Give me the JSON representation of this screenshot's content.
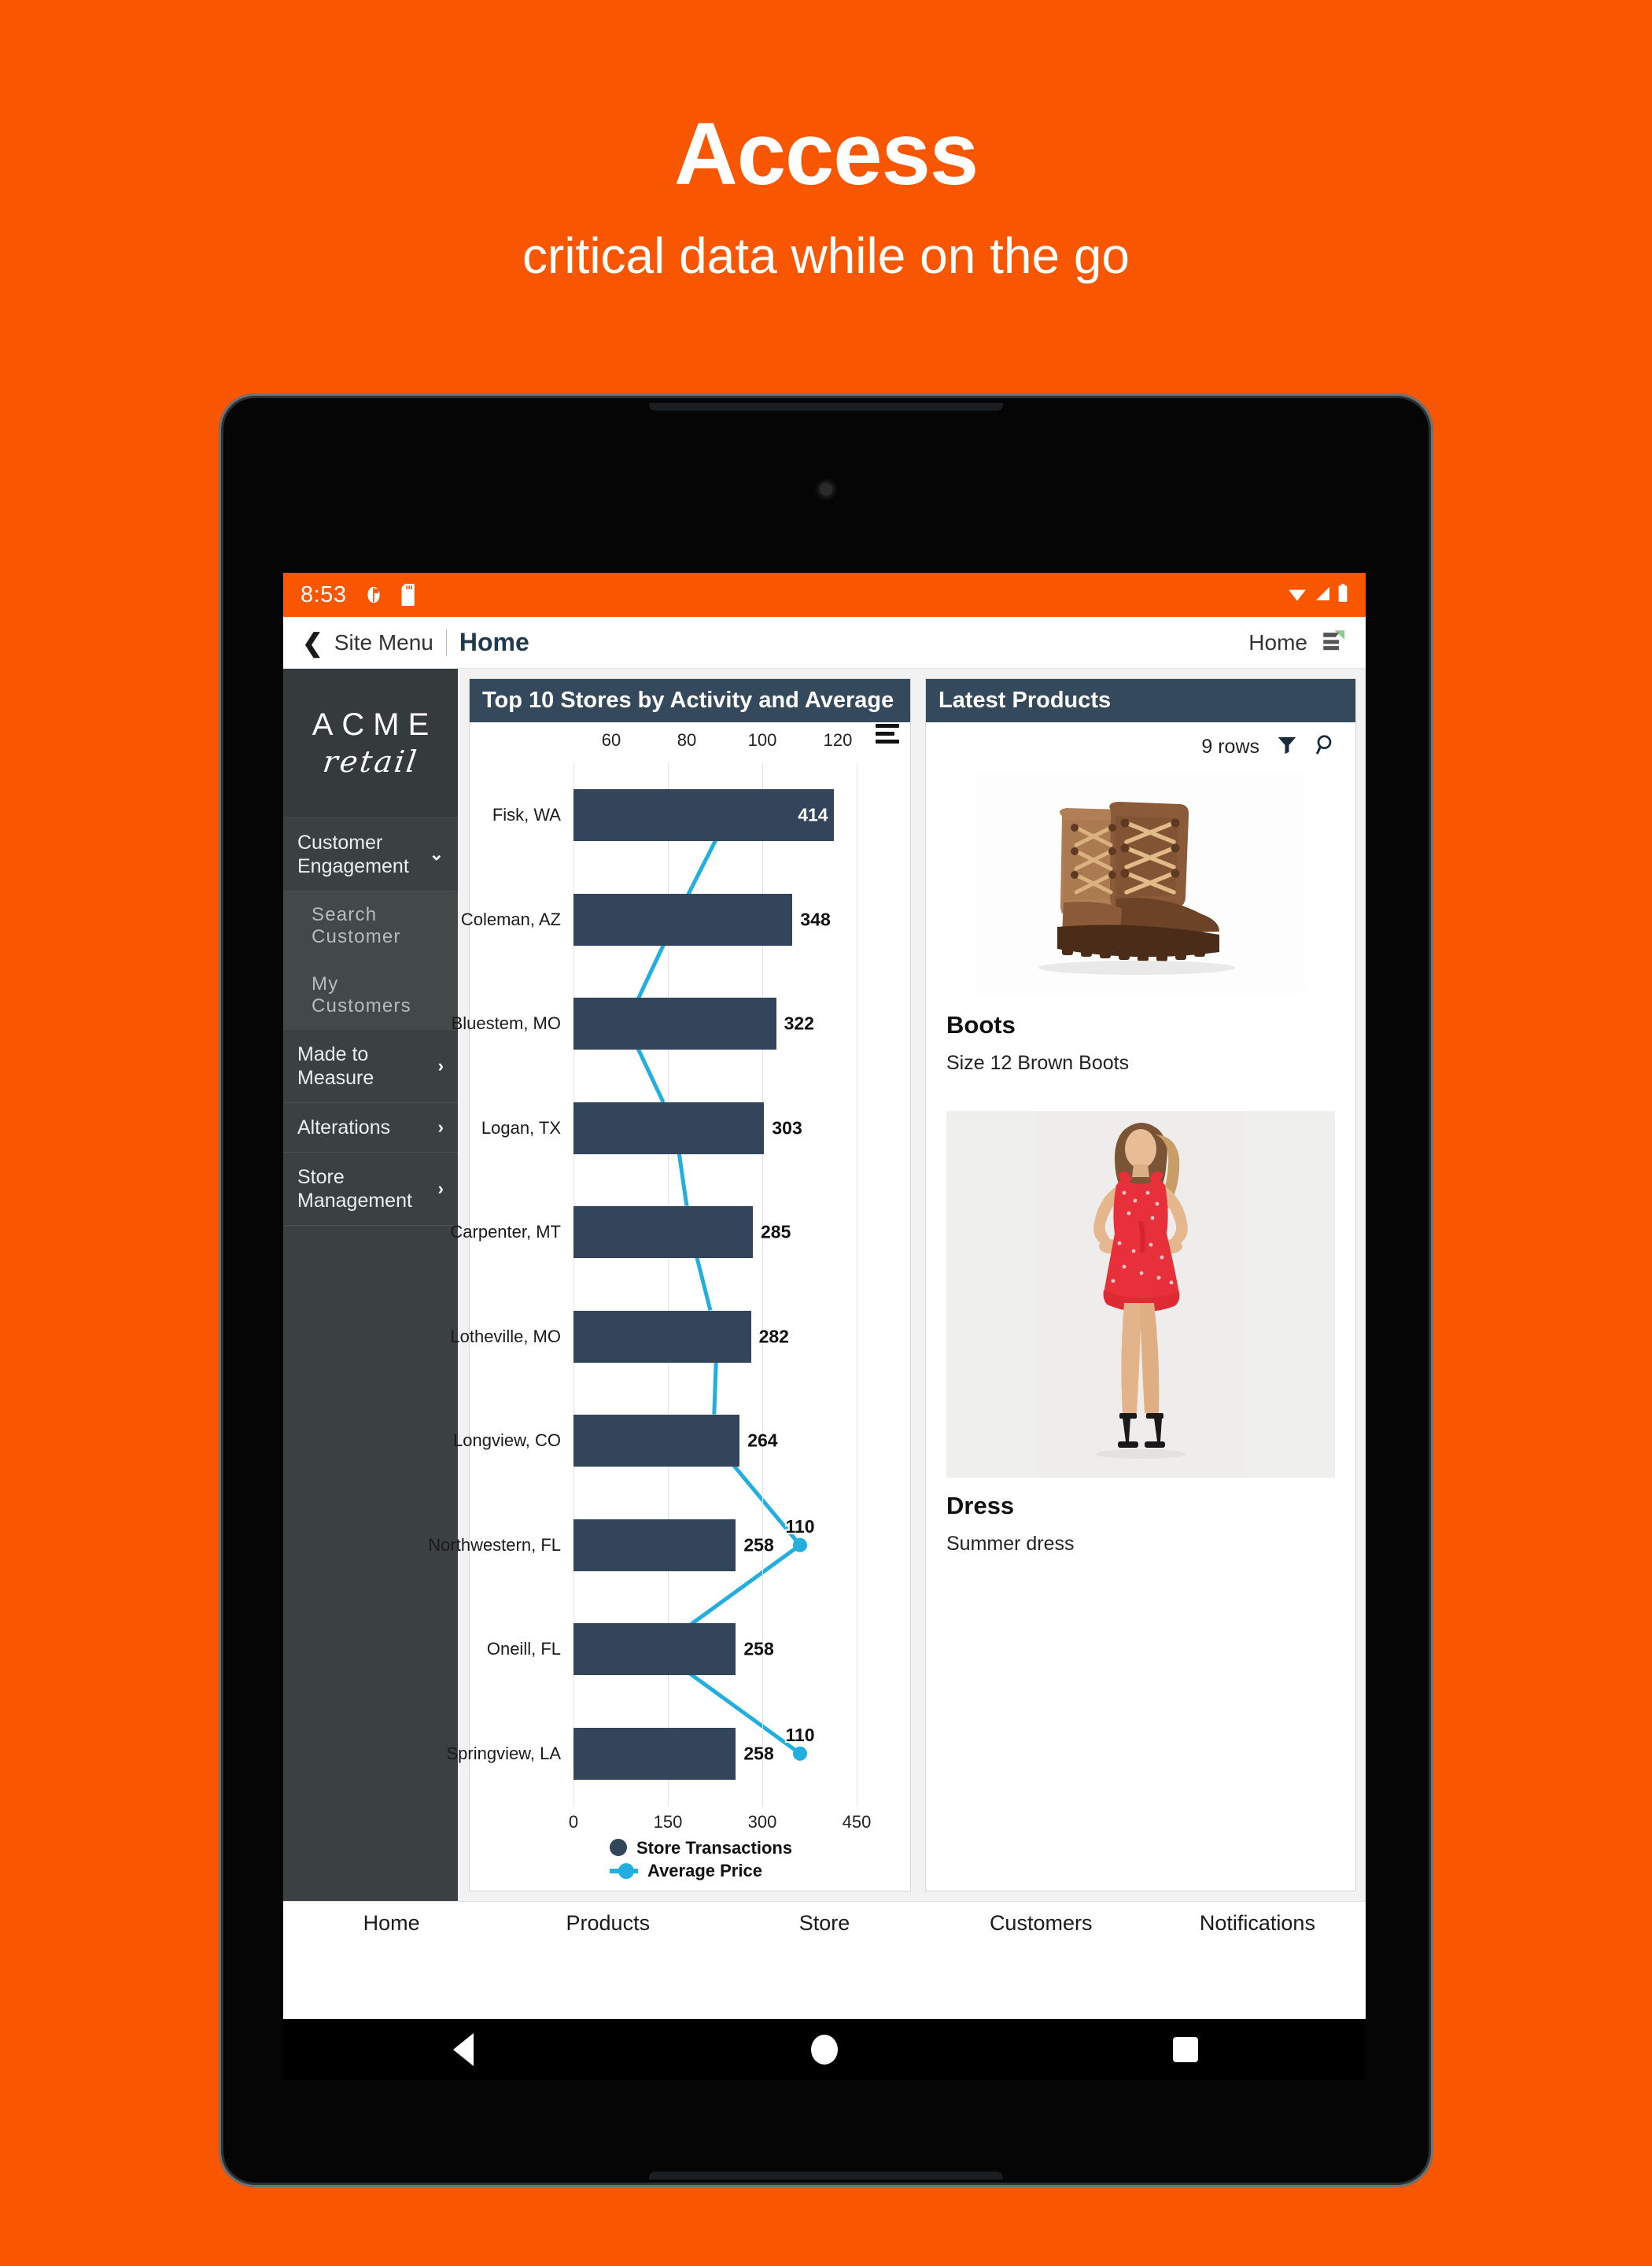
{
  "promo": {
    "title": "Access",
    "subtitle": "critical data while on the go"
  },
  "status_bar": {
    "time": "8:53",
    "icons": [
      "screen-rotation-icon",
      "sd-card-icon"
    ],
    "right_icons": [
      "wifi-icon",
      "signal-icon",
      "battery-icon"
    ]
  },
  "app_header": {
    "back_icon": "chevron-left-icon",
    "site_menu": "Site Menu",
    "page_title": "Home",
    "right_label": "Home",
    "right_icon": "layers-icon"
  },
  "sidebar": {
    "logo_primary": "ACME",
    "logo_secondary": "retail",
    "items": [
      {
        "label": "Customer Engagement",
        "icon": "chevron-down-icon",
        "expanded": true
      },
      {
        "label": "Search Customer",
        "sub": true
      },
      {
        "label": "My Customers",
        "sub": true
      },
      {
        "label": "Made to Measure",
        "icon": "chevron-right-icon"
      },
      {
        "label": "Alterations",
        "icon": "chevron-right-icon"
      },
      {
        "label": "Store Management",
        "icon": "chevron-right-icon"
      }
    ]
  },
  "chart_card": {
    "title": "Top 10 Stores by Activity and Average",
    "menu_icon": "hamburger-menu-icon"
  },
  "chart_data": {
    "type": "bar",
    "title": "Top 10 Stores by Activity and Average",
    "orientation": "horizontal",
    "categories": [
      "Fisk, WA",
      "Coleman, AZ",
      "Bluestem, MO",
      "Logan, TX",
      "Carpenter, MT",
      "Lotheville, MO",
      "Longview, CO",
      "Northwestern, FL",
      "Oneill, FL",
      "Springview, LA"
    ],
    "series": [
      {
        "name": "Store Transactions",
        "type": "bar",
        "color": "#33455a",
        "values": [
          414,
          348,
          322,
          303,
          285,
          282,
          264,
          258,
          258,
          258
        ],
        "axis": "bottom",
        "axis_label": "",
        "ticks": [
          0,
          150,
          300,
          450
        ],
        "range": [
          0,
          450
        ]
      },
      {
        "name": "Average Price",
        "type": "line",
        "color": "#22aede",
        "values": [
          91,
          77,
          64,
          77,
          81,
          88,
          87,
          110,
          72,
          110
        ],
        "axis": "top",
        "ticks": [
          60,
          80,
          100,
          120
        ],
        "range": [
          50,
          125
        ]
      }
    ],
    "legend": [
      "Store Transactions",
      "Average Price"
    ],
    "legend_position": "bottom-left",
    "grid": true
  },
  "products_card": {
    "title": "Latest Products",
    "rows_label": "9 rows",
    "filter_icon": "filter-icon",
    "search_icon": "search-icon",
    "items": [
      {
        "name": "Boots",
        "description": "Size 12 Brown Boots",
        "image": "brown-leather-boots-photo"
      },
      {
        "name": "Dress",
        "description": "Summer dress",
        "image": "red-summer-dress-photo"
      }
    ]
  },
  "tab_bar": {
    "tabs": [
      "Home",
      "Products",
      "Store",
      "Customers",
      "Notifications"
    ]
  },
  "android_nav": {
    "back": "back-triangle-icon",
    "home": "home-circle-icon",
    "recents": "recents-square-icon"
  },
  "colors": {
    "brand_orange": "#f95601",
    "card_header": "#35495c",
    "bar": "#33455a",
    "line": "#22aede",
    "sidebar": "#3b4042"
  }
}
